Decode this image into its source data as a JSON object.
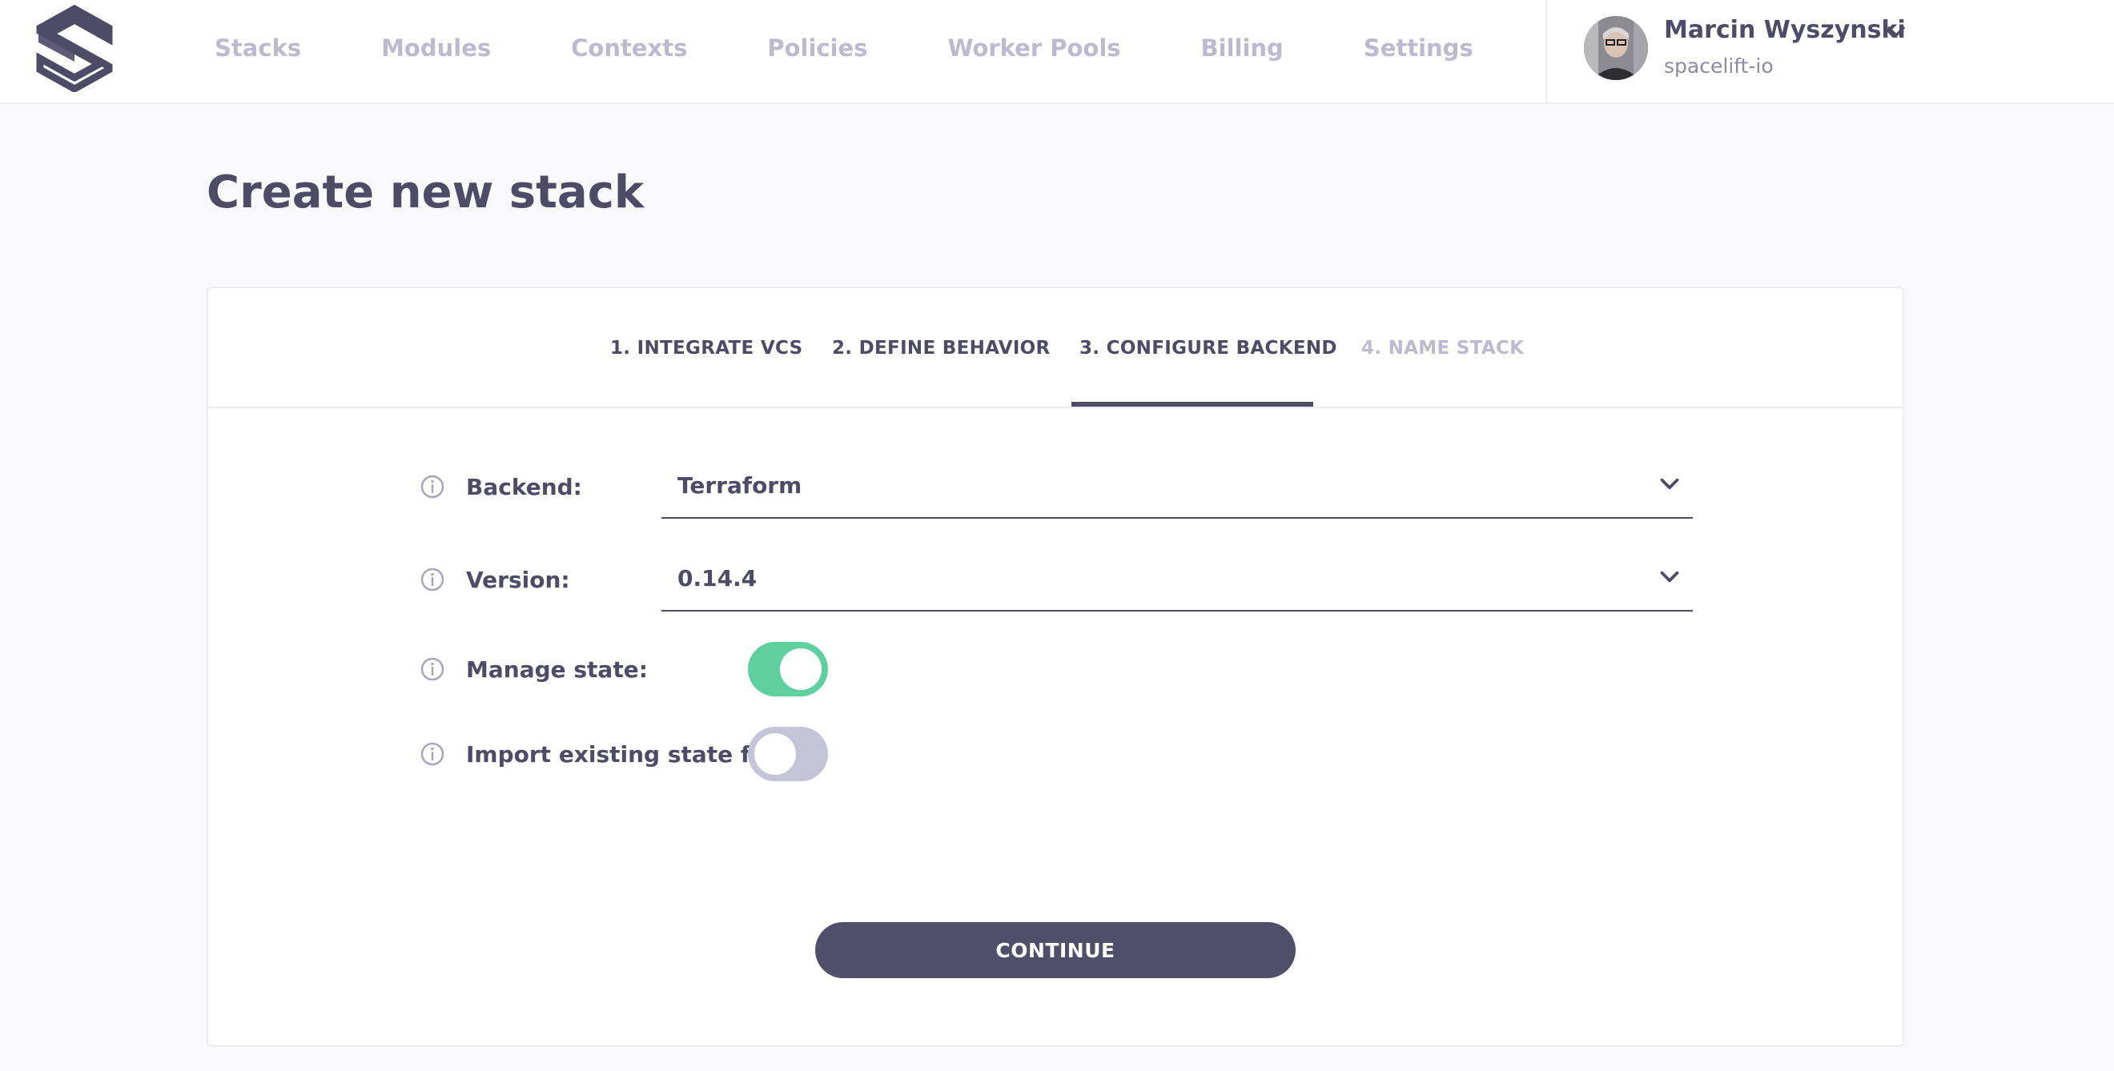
{
  "brand": {
    "logo_icon": "spacelift-logo-icon"
  },
  "nav": {
    "items": [
      {
        "label": "Stacks"
      },
      {
        "label": "Modules"
      },
      {
        "label": "Contexts"
      },
      {
        "label": "Policies"
      },
      {
        "label": "Worker Pools"
      },
      {
        "label": "Billing"
      },
      {
        "label": "Settings"
      }
    ]
  },
  "user": {
    "name": "Marcin Wyszynski",
    "org": "spacelift-io",
    "menu_icon": "chevron-down-icon"
  },
  "page": {
    "title": "Create new stack"
  },
  "steps": [
    {
      "label": "1. INTEGRATE VCS",
      "state": "done"
    },
    {
      "label": "2. DEFINE BEHAVIOR",
      "state": "done"
    },
    {
      "label": "3. CONFIGURE BACKEND",
      "state": "active"
    },
    {
      "label": "4. NAME STACK",
      "state": "disabled"
    }
  ],
  "form": {
    "backend": {
      "label": "Backend:",
      "value": "Terraform"
    },
    "version": {
      "label": "Version:",
      "value": "0.14.4"
    },
    "manage_state": {
      "label": "Manage state:",
      "enabled": true
    },
    "import_state": {
      "label": "Import existing state file:",
      "enabled": false
    }
  },
  "actions": {
    "continue_label": "CONTINUE"
  },
  "colors": {
    "primary": "#4e4b66",
    "muted": "#bdbad0",
    "toggle_on": "#5fcf9f",
    "toggle_off": "#c5c3d8",
    "button": "#514e6a",
    "background": "#f9f9fc"
  }
}
